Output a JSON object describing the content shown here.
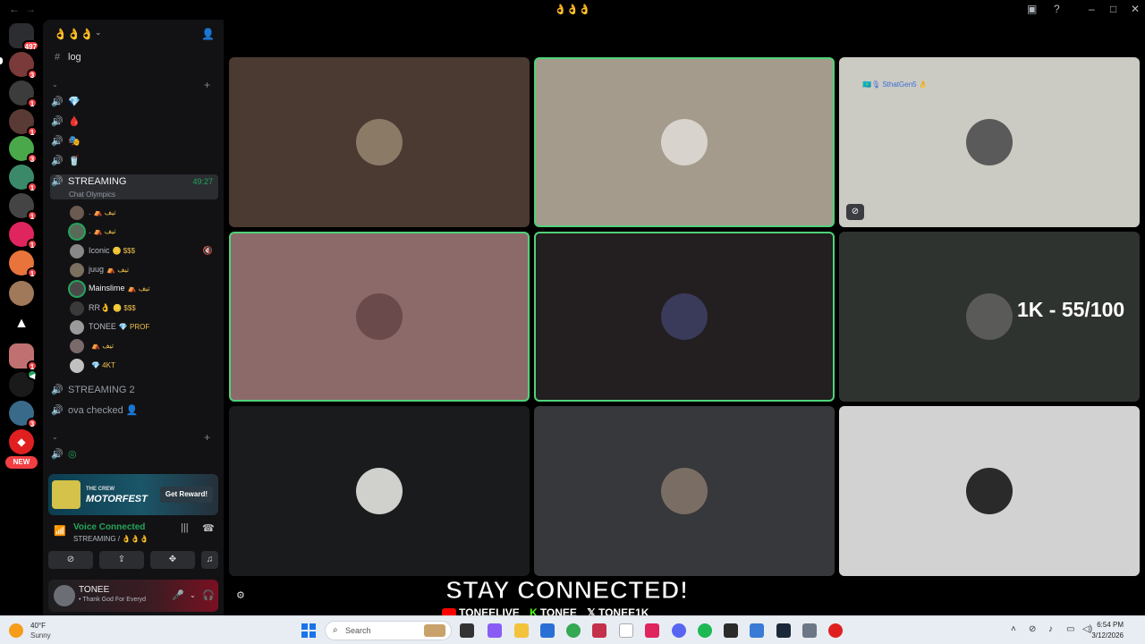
{
  "window": {
    "title": "👌👌👌"
  },
  "server": {
    "name": "👌👌👌",
    "mention_count": "497"
  },
  "rail_badges": [
    "3",
    "1",
    "1",
    "1",
    "3",
    "1",
    "1",
    "1",
    "1",
    "1",
    "1",
    "3"
  ],
  "new_label": "NEW",
  "channels": {
    "text_log": "log",
    "voice_top": [
      "💎",
      "🩸",
      "🎭",
      "🥤"
    ],
    "streaming": {
      "name": "STREAMING",
      "activity": "Chat Olympics",
      "timer": "49:27"
    },
    "members": [
      {
        "name": ".",
        "tag": "⛺ تیف"
      },
      {
        "name": ".",
        "tag": "⛺ تیف"
      },
      {
        "name": "Iconic",
        "tag": "🪙 $$$"
      },
      {
        "name": "juug",
        "tag": "⛺ تیف"
      },
      {
        "name": "Mainslime",
        "tag": "⛺ تیف"
      },
      {
        "name": "RR👌",
        "tag": "🪙 $$$"
      },
      {
        "name": "TONEE",
        "tag": "💎 PROF"
      },
      {
        "name": "",
        "tag": "⛺ تیف"
      },
      {
        "name": "",
        "tag": "💎 4KT"
      }
    ],
    "streaming2": "STREAMING 2",
    "ova_checked": "ova checked 👤"
  },
  "promo": {
    "game_small": "THE CREW",
    "game": "MOTORFEST",
    "button": "Get Reward!"
  },
  "voice": {
    "status": "Voice Connected",
    "location": "STREAMING / 👌👌👌"
  },
  "user": {
    "name": "TONEE",
    "status": "• Thank God For Everyd"
  },
  "tiles": [
    {
      "bg": "#4a3a32",
      "avatar": "#8b7a66",
      "speaking": false,
      "name": ""
    },
    {
      "bg": "#a59b8d",
      "avatar": "#d8d3cc",
      "speaking": true,
      "name": ""
    },
    {
      "bg": "#cbcac3",
      "avatar": "#5a5a5a",
      "speaking": false,
      "name": "🇰🇿🎙 SthatGen5 👌"
    },
    {
      "bg": "#8d6a6a",
      "avatar": "#6a4a4a",
      "speaking": true,
      "name": ""
    },
    {
      "bg": "#231e20",
      "avatar": "#3a3a5a",
      "speaking": true,
      "name": ""
    },
    {
      "bg": "#2f332f",
      "avatar": "#5a5a58",
      "speaking": false,
      "name": ""
    },
    {
      "bg": "#1a1b1d",
      "avatar": "#d0d0cc",
      "speaking": false,
      "name": ""
    },
    {
      "bg": "#36383c",
      "avatar": "#7a6e64",
      "speaking": false,
      "name": ""
    },
    {
      "bg": "#d2d2d2",
      "avatar": "#2a2a2a",
      "speaking": false,
      "name": ""
    }
  ],
  "goal_overlay": "1K - 55/100",
  "stream_overlay": {
    "headline": "STAY CONNECTED!",
    "youtube": "TONEELIVE",
    "kick": "TONEE",
    "x": "TONEE1K"
  },
  "taskbar": {
    "weather_temp": "40°F",
    "weather_cond": "Sunny",
    "search_placeholder": "Search",
    "time": "6:54 PM",
    "date": "3/12/2026"
  }
}
